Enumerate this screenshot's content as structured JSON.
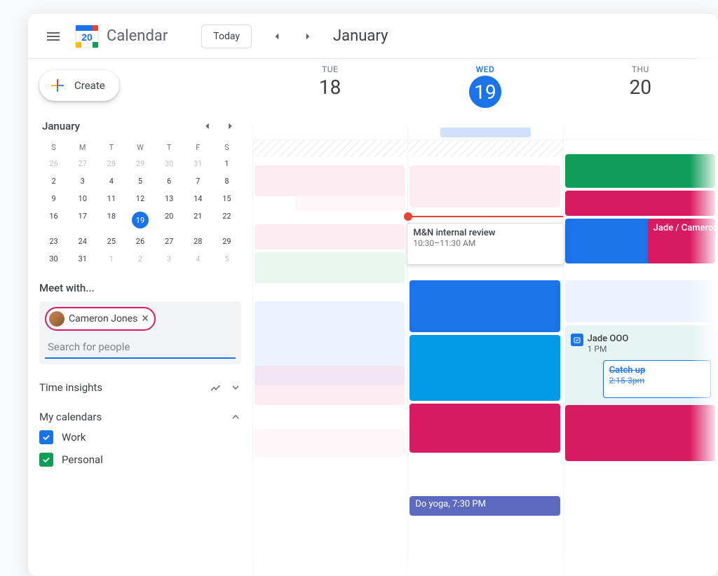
{
  "header": {
    "app_title": "Calendar",
    "today_label": "Today",
    "month_title": "January",
    "logo_day": "20"
  },
  "sidebar": {
    "create_label": "Create",
    "minical": {
      "month": "January",
      "dow": [
        "S",
        "M",
        "T",
        "W",
        "T",
        "F",
        "S"
      ],
      "days": [
        {
          "n": "26",
          "m": true
        },
        {
          "n": "27",
          "m": true
        },
        {
          "n": "28",
          "m": true
        },
        {
          "n": "29",
          "m": true
        },
        {
          "n": "30",
          "m": true
        },
        {
          "n": "31",
          "m": true
        },
        {
          "n": "1"
        },
        {
          "n": "2"
        },
        {
          "n": "3"
        },
        {
          "n": "4"
        },
        {
          "n": "5"
        },
        {
          "n": "6"
        },
        {
          "n": "7"
        },
        {
          "n": "8"
        },
        {
          "n": "9"
        },
        {
          "n": "10"
        },
        {
          "n": "11"
        },
        {
          "n": "12"
        },
        {
          "n": "13"
        },
        {
          "n": "14"
        },
        {
          "n": "15"
        },
        {
          "n": "16"
        },
        {
          "n": "17"
        },
        {
          "n": "18"
        },
        {
          "n": "19",
          "today": true
        },
        {
          "n": "20"
        },
        {
          "n": "21"
        },
        {
          "n": "22"
        },
        {
          "n": "23"
        },
        {
          "n": "24"
        },
        {
          "n": "25"
        },
        {
          "n": "26"
        },
        {
          "n": "27"
        },
        {
          "n": "28"
        },
        {
          "n": "29"
        },
        {
          "n": "30"
        },
        {
          "n": "31"
        },
        {
          "n": "1",
          "m": true
        },
        {
          "n": "2",
          "m": true
        },
        {
          "n": "3",
          "m": true
        },
        {
          "n": "4",
          "m": true
        },
        {
          "n": "5",
          "m": true
        }
      ]
    },
    "meet_label": "Meet with...",
    "chip_name": "Cameron Jones",
    "search_placeholder": "Search for people",
    "time_insights_label": "Time insights",
    "my_calendars_label": "My calendars",
    "calendars": [
      {
        "label": "Work",
        "color": "#1a73e8"
      },
      {
        "label": "Personal",
        "color": "#0f9d58"
      }
    ]
  },
  "grid": {
    "days": [
      {
        "dow": "TUE",
        "num": "18"
      },
      {
        "dow": "WED",
        "num": "19",
        "active": true
      },
      {
        "dow": "THU",
        "num": "20"
      }
    ],
    "popup": {
      "title": "M&N internal review",
      "time": "10:30–11:30 AM"
    },
    "ooo": {
      "title": "Jade OOO",
      "time": "1 PM"
    },
    "catchup": {
      "title": "Catch up",
      "time": "2:15-3pm"
    },
    "jade_cameron": "Jade / Cameron",
    "do_yoga": "Do yoga, 7:30 PM",
    "colors": {
      "pink_light": "#fad2e1",
      "pink_pale": "#fce8ef",
      "magenta": "#d81b60",
      "blue": "#1a73e8",
      "blue_cyan": "#039be5",
      "blue_pale": "#d0e1fc",
      "green": "#0f9d58",
      "green_pale": "#c7ead6",
      "indigo": "#5c6bc0",
      "teal_pale": "#cce8e8"
    }
  }
}
